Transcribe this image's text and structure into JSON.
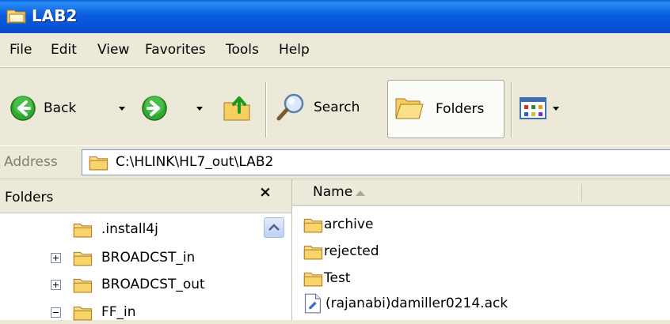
{
  "window": {
    "title": "LAB2"
  },
  "menu": [
    "File",
    "Edit",
    "View",
    "Favorites",
    "Tools",
    "Help"
  ],
  "toolbar": {
    "back_label": "Back",
    "search_label": "Search",
    "folders_label": "Folders"
  },
  "address": {
    "label": "Address",
    "value": "C:\\HLINK\\HL7_out\\LAB2"
  },
  "folders_pane": {
    "title": "Folders",
    "close_glyph": "×",
    "items": [
      {
        "label": ".install4j",
        "expander": ""
      },
      {
        "label": "BROADCST_in",
        "expander": "+"
      },
      {
        "label": "BROADCST_out",
        "expander": "+"
      },
      {
        "label": "FF_in",
        "expander": "-"
      }
    ]
  },
  "file_list": {
    "column_name": "Name",
    "items": [
      {
        "label": "archive",
        "icon": "folder-icon"
      },
      {
        "label": "rejected",
        "icon": "folder-icon"
      },
      {
        "label": "Test",
        "icon": "folder-icon"
      },
      {
        "label": "(rajanabi)damiller0214.ack",
        "icon": "file-icon"
      }
    ]
  },
  "colors": {
    "titlebar": "#0b5ee0",
    "chrome": "#ece9d8",
    "folder": "#f4c95a"
  }
}
